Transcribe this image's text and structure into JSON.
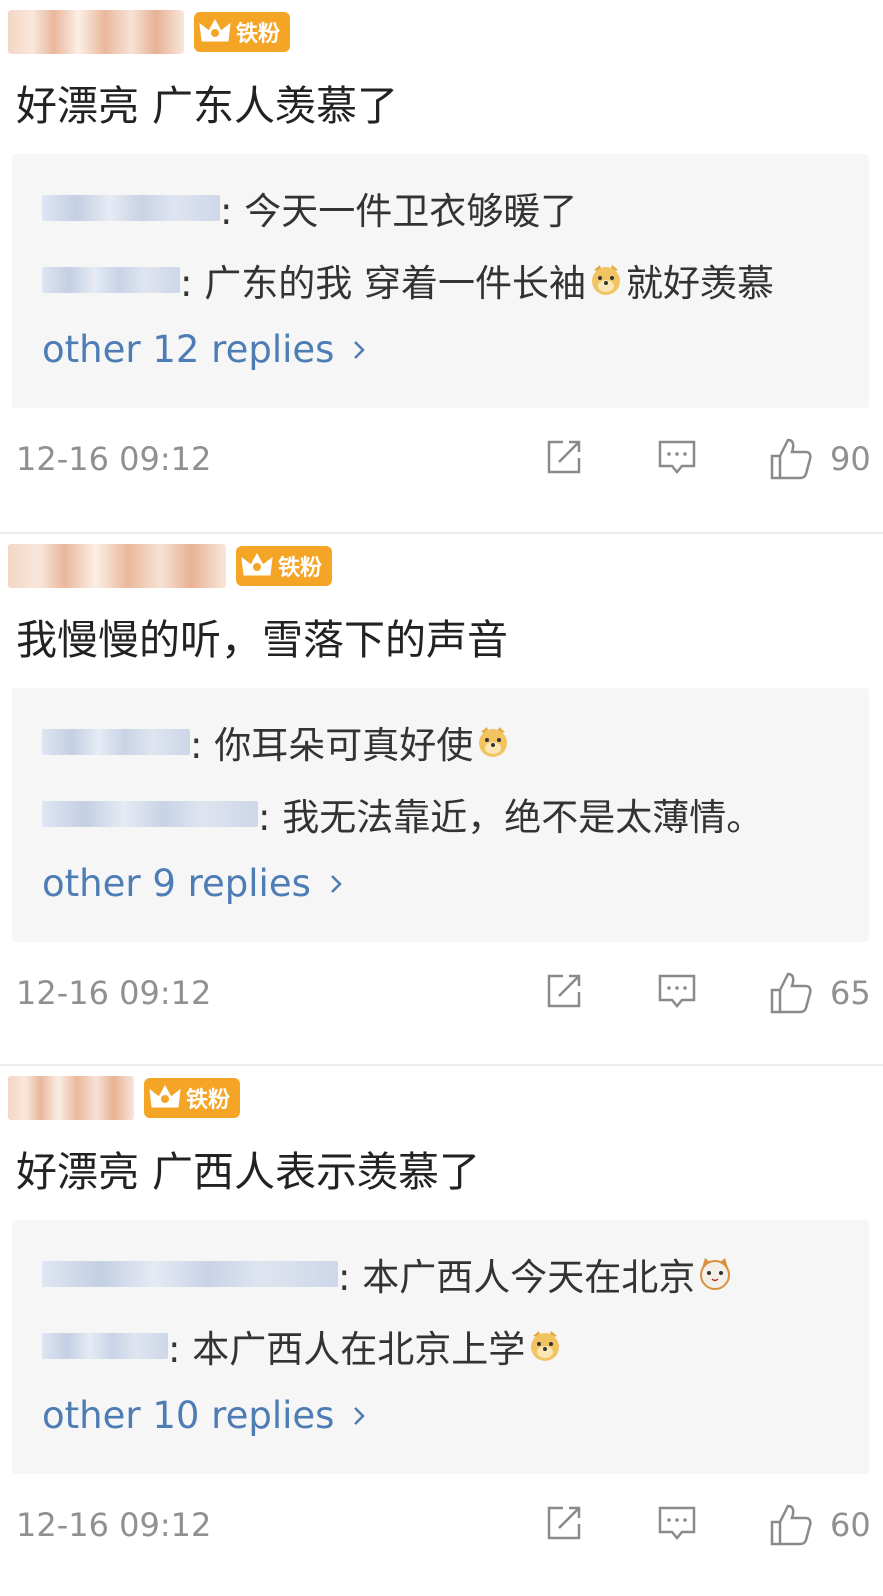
{
  "colors": {
    "badge": "#f5a526",
    "link": "#4d7db4",
    "meta_text": "#909090",
    "reply_bg": "#f6f6f6"
  },
  "comments": [
    {
      "badge": {
        "label": "铁粉",
        "level": "5"
      },
      "text": "好漂亮 广东人羡慕了",
      "replies": [
        {
          "text": ": 今天一件卫衣够暖了",
          "emoji": null,
          "tail": ""
        },
        {
          "text": ": 广东的我 穿着一件长袖",
          "emoji": "doge-emoji",
          "tail": "就好羡慕"
        }
      ],
      "more_replies": "other 12 replies",
      "time": "12-16 09:12",
      "likes": "90"
    },
    {
      "badge": {
        "label": "铁粉",
        "level": "5"
      },
      "text": "我慢慢的听，雪落下的声音",
      "replies": [
        {
          "text": ": 你耳朵可真好使",
          "emoji": "doge-emoji",
          "tail": ""
        },
        {
          "text": ": 我无法靠近，绝不是太薄情。",
          "emoji": null,
          "tail": ""
        }
      ],
      "more_replies": "other 9 replies",
      "time": "12-16 09:12",
      "likes": "65"
    },
    {
      "badge": {
        "label": "铁粉",
        "level": "1"
      },
      "text": "好漂亮 广西人表示羡慕了",
      "replies": [
        {
          "text": ": 本广西人今天在北京",
          "emoji": "cat-emoji",
          "tail": ""
        },
        {
          "text": ": 本广西人在北京上学",
          "emoji": "doge-emoji",
          "tail": ""
        }
      ],
      "more_replies": "other 10 replies",
      "time": "12-16 09:12",
      "likes": "60"
    }
  ]
}
